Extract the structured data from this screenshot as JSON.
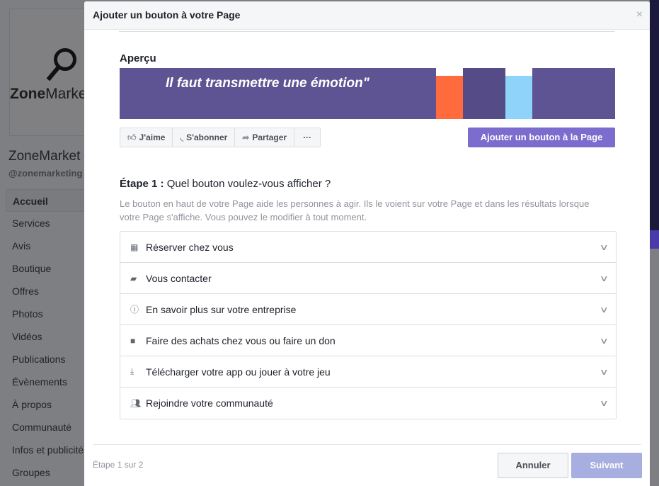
{
  "background": {
    "page_name": "ZoneMarket",
    "page_handle": "@zonemarketing",
    "logo_text_bold": "Zone",
    "logo_text": "Marke",
    "nav": [
      "Accueil",
      "Services",
      "Avis",
      "Boutique",
      "Offres",
      "Photos",
      "Vidéos",
      "Publications",
      "Évènements",
      "À propos",
      "Communauté",
      "Infos et publicité",
      "Groupes"
    ]
  },
  "modal": {
    "title": "Ajouter un bouton à votre Page",
    "close": "×",
    "preview_label": "Aperçu",
    "cover_quote": "Il faut transmettre une émotion\"",
    "cover_colors": {
      "base": "#5e5493",
      "orange": "#ff6b3d",
      "blue": "#8fd3fb"
    },
    "actions": [
      {
        "icon": "thumbs-up-icon",
        "label": "J'aime"
      },
      {
        "icon": "rss-icon",
        "label": "S'abonner"
      },
      {
        "icon": "share-icon",
        "label": "Partager"
      },
      {
        "icon": "more-icon",
        "label": "···"
      }
    ],
    "add_button": "Ajouter un bouton à la Page",
    "step_prefix": "Étape 1 :",
    "step_question": "Quel bouton voulez-vous afficher ?",
    "description": "Le bouton en haut de votre Page aide les personnes à agir. Ils le voient sur votre Page et dans les résultats lorsque votre Page s'affiche. Vous pouvez le modifier à tout moment.",
    "options": [
      {
        "icon": "calendar-icon",
        "label": "Réserver chez vous"
      },
      {
        "icon": "chat-icon",
        "label": "Vous contacter"
      },
      {
        "icon": "info-icon",
        "label": "En savoir plus sur votre entreprise"
      },
      {
        "icon": "shopping-bag-icon",
        "label": "Faire des achats chez vous ou faire un don"
      },
      {
        "icon": "download-icon",
        "label": "Télécharger votre app ou jouer à votre jeu"
      },
      {
        "icon": "people-icon",
        "label": "Rejoindre votre communauté"
      }
    ],
    "step_count": "Étape 1 sur 2",
    "cancel": "Annuler",
    "next": "Suivant",
    "accent": "#7b6ccd"
  }
}
